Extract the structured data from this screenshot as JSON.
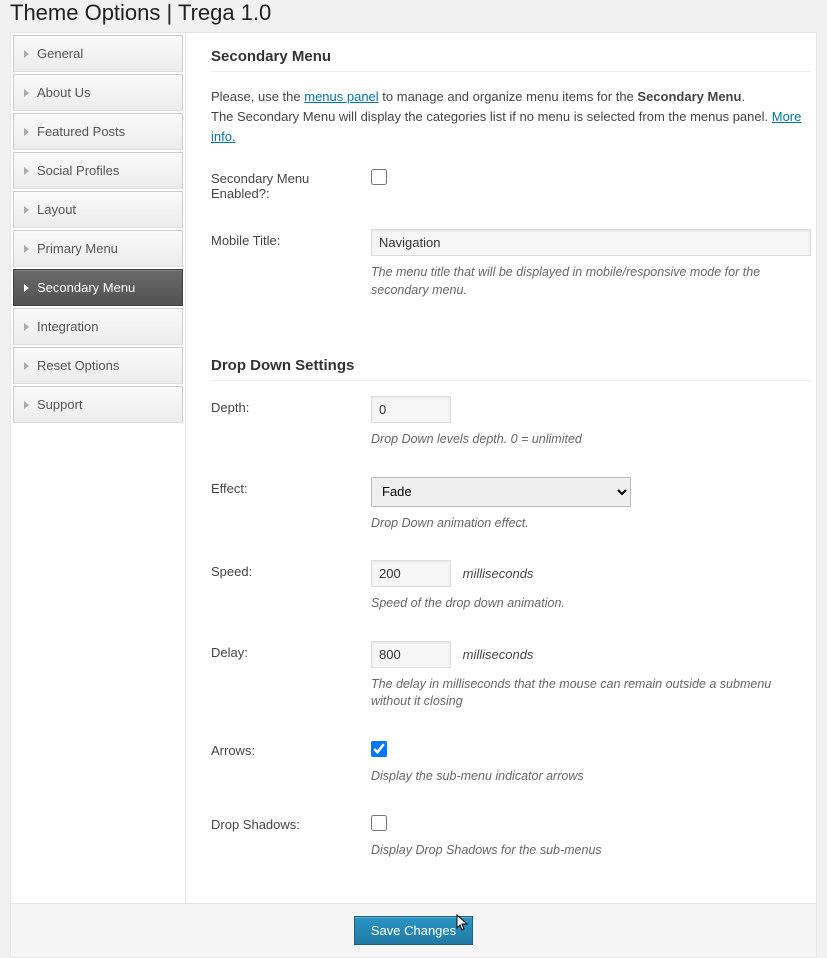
{
  "header": {
    "title": "Theme Options | Trega 1.0"
  },
  "sidebar": {
    "items": [
      {
        "label": "General"
      },
      {
        "label": "About Us"
      },
      {
        "label": "Featured Posts"
      },
      {
        "label": "Social Profiles"
      },
      {
        "label": "Layout"
      },
      {
        "label": "Primary Menu"
      },
      {
        "label": "Secondary Menu",
        "active": true
      },
      {
        "label": "Integration"
      },
      {
        "label": "Reset Options"
      },
      {
        "label": "Support"
      }
    ]
  },
  "section1": {
    "title": "Secondary Menu",
    "intro_pre": "Please, use the ",
    "intro_link": "menus panel",
    "intro_mid": " to manage and organize menu items for the ",
    "intro_bold": "Secondary Menu",
    "intro_post": ".",
    "intro_line2_pre": "The Secondary Menu will display the categories list if no menu is selected from the menus panel. ",
    "intro_line2_link": "More info."
  },
  "fields": {
    "enabled": {
      "label": "Secondary Menu Enabled?:",
      "checked": false
    },
    "mobile_title": {
      "label": "Mobile Title:",
      "value": "Navigation",
      "help": "The menu title that will be displayed in mobile/responsive mode for the secondary menu."
    }
  },
  "section2": {
    "title": "Drop Down Settings"
  },
  "dd": {
    "depth": {
      "label": "Depth:",
      "value": "0",
      "help": "Drop Down levels depth. 0 = unlimited"
    },
    "effect": {
      "label": "Effect:",
      "value": "Fade",
      "help": "Drop Down animation effect."
    },
    "speed": {
      "label": "Speed:",
      "value": "200",
      "unit": "milliseconds",
      "help": "Speed of the drop down animation."
    },
    "delay": {
      "label": "Delay:",
      "value": "800",
      "unit": "milliseconds",
      "help": "The delay in milliseconds that the mouse can remain outside a submenu without it closing"
    },
    "arrows": {
      "label": "Arrows:",
      "checked": true,
      "help": "Display the sub-menu indicator arrows"
    },
    "shadows": {
      "label": "Drop Shadows:",
      "checked": false,
      "help": "Display Drop Shadows for the sub-menus"
    }
  },
  "footer": {
    "save_label": "Save Changes"
  }
}
